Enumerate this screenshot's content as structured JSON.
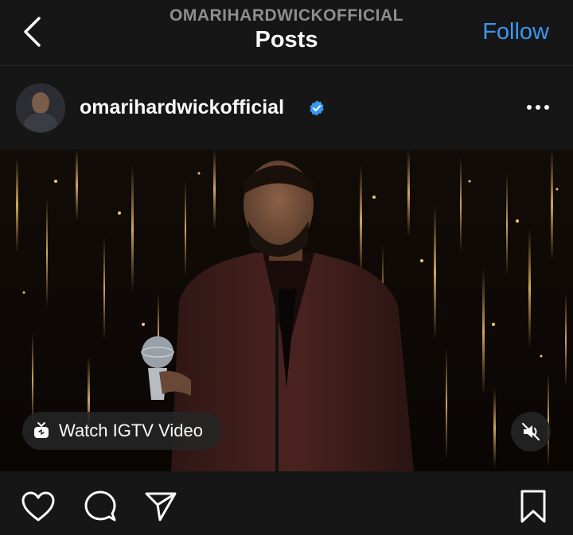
{
  "nav": {
    "username": "OMARIHARDWICKOFFICIAL",
    "title": "Posts",
    "follow_label": "Follow"
  },
  "post": {
    "username": "omarihardwickofficial",
    "verified": true,
    "igtv_label": "Watch IGTV Video",
    "muted": true
  },
  "icons": {
    "back": "chevron-left-icon",
    "verified": "verified-badge-icon",
    "more": "ellipsis-icon",
    "igtv": "igtv-icon",
    "mute": "speaker-muted-icon",
    "like": "heart-icon",
    "comment": "comment-icon",
    "share": "send-icon",
    "save": "bookmark-icon"
  },
  "colors": {
    "accent": "#3897f0",
    "background": "#000000",
    "bar": "#161616",
    "verified": "#3897f0"
  }
}
